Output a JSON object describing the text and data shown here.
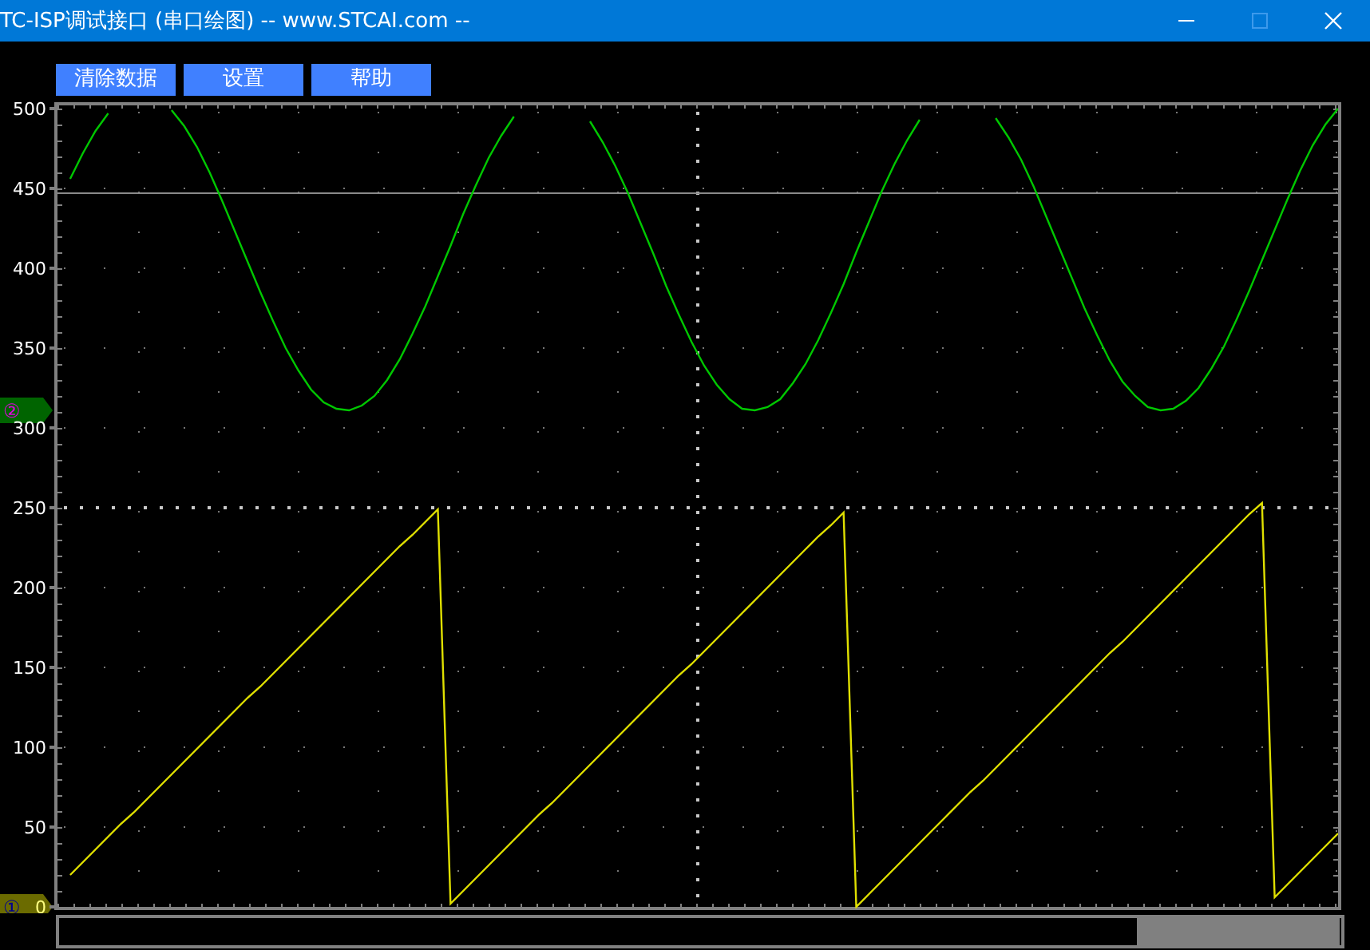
{
  "window": {
    "title": "TC-ISP调试接口 (串口绘图) -- www.STCAI.com --"
  },
  "toolbar": {
    "buttons": [
      "清除数据",
      "设置",
      "帮助"
    ]
  },
  "plot": {
    "channel_markers": [
      {
        "label": "②",
        "color": "#006400"
      },
      {
        "label": "①",
        "color": "#6b6b00"
      }
    ],
    "chart_data": {
      "type": "line",
      "grid": true,
      "ylim": [
        0,
        500
      ],
      "yticks": [
        0,
        50,
        100,
        150,
        200,
        250,
        300,
        350,
        400,
        450,
        500
      ],
      "ref_lines": [
        {
          "value": 447,
          "axis": "y",
          "color": "#8a8a8a"
        }
      ],
      "series": [
        {
          "color": "#00c800",
          "values": [
            456,
            472,
            486,
            497,
            null,
            null,
            null,
            null,
            499,
            489,
            476,
            460,
            442,
            423,
            404,
            385,
            367,
            350,
            336,
            324,
            316,
            312,
            311,
            314,
            320,
            330,
            343,
            359,
            376,
            395,
            414,
            434,
            452,
            469,
            483,
            495,
            null,
            null,
            null,
            null,
            null,
            492,
            479,
            464,
            447,
            428,
            409,
            389,
            371,
            354,
            339,
            327,
            318,
            312,
            311,
            313,
            318,
            328,
            340,
            355,
            372,
            390,
            410,
            429,
            448,
            465,
            480,
            493,
            null,
            null,
            null,
            null,
            null,
            494,
            482,
            468,
            451,
            432,
            413,
            394,
            375,
            358,
            342,
            329,
            320,
            313,
            311,
            312,
            317,
            325,
            337,
            351,
            368,
            386,
            405,
            424,
            443,
            461,
            477,
            490,
            500
          ]
        },
        {
          "color": "#e0e000",
          "values": [
            20,
            28,
            36,
            44,
            52,
            59,
            67,
            75,
            83,
            91,
            99,
            107,
            115,
            123,
            131,
            138,
            146,
            154,
            162,
            170,
            178,
            186,
            194,
            202,
            210,
            218,
            226,
            233,
            241,
            249,
            2,
            10,
            18,
            26,
            34,
            42,
            50,
            58,
            65,
            73,
            81,
            89,
            97,
            105,
            113,
            121,
            129,
            137,
            145,
            152,
            160,
            168,
            176,
            184,
            192,
            200,
            208,
            216,
            224,
            232,
            239,
            247,
            0,
            8,
            16,
            24,
            32,
            40,
            48,
            56,
            64,
            72,
            79,
            87,
            95,
            103,
            111,
            119,
            127,
            135,
            143,
            151,
            159,
            166,
            174,
            182,
            190,
            198,
            206,
            214,
            222,
            230,
            238,
            246,
            253,
            6,
            14,
            22,
            30,
            38,
            46
          ]
        }
      ]
    }
  }
}
